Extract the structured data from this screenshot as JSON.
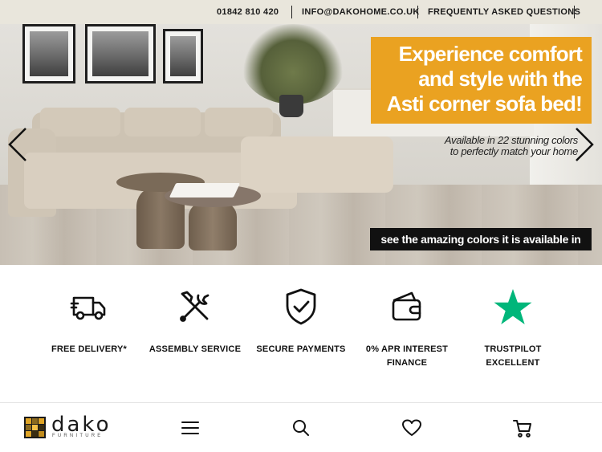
{
  "topbar": {
    "phone": "01842 810 420",
    "email": "INFO@DAKOHOME.CO.UK",
    "faq": "FREQUENTLY ASKED QUESTIONS"
  },
  "hero": {
    "headline": [
      "Experience comfort",
      "and style with the",
      "Asti corner sofa bed!"
    ],
    "subline": [
      "Available in 22 stunning colors",
      "to perfectly match your home"
    ],
    "cta": "see the amazing colors it is available in",
    "accent_color": "#eaa221"
  },
  "features": [
    {
      "label": [
        "FREE DELIVERY*"
      ],
      "icon": "delivery-truck-icon"
    },
    {
      "label": [
        "ASSEMBLY SERVICE"
      ],
      "icon": "tools-icon"
    },
    {
      "label": [
        "SECURE PAYMENTS"
      ],
      "icon": "shield-check-icon"
    },
    {
      "label": [
        "0% APR INTEREST",
        "FINANCE"
      ],
      "icon": "wallet-icon"
    },
    {
      "label": [
        "TRUSTPILOT",
        "EXCELLENT"
      ],
      "icon": "trustpilot-star-icon",
      "color": "#00b67a"
    }
  ],
  "bottom_nav": {
    "logo_word": "dako",
    "logo_tag": "FURNITURE",
    "icons": [
      "menu-icon",
      "search-icon",
      "heart-icon",
      "cart-icon"
    ]
  }
}
